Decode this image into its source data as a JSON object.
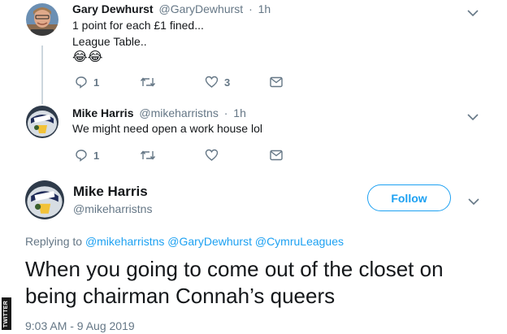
{
  "tweet1": {
    "name": "Gary Dewhurst",
    "handle": "@GaryDewhurst",
    "separator": "·",
    "time": "1h",
    "line1": "1 point for each £1 fined...",
    "line2": "League Table..",
    "emoji": "😂😂",
    "actions": {
      "replies": "1",
      "retweets": "",
      "likes": "3"
    }
  },
  "tweet2": {
    "name": "Mike Harris",
    "handle": "@mikeharristns",
    "separator": "·",
    "time": "1h",
    "text": "We might need open a work house lol",
    "actions": {
      "replies": "1",
      "retweets": "",
      "likes": ""
    }
  },
  "main_tweet": {
    "name": "Mike Harris",
    "handle": "@mikeharristns",
    "follow_label": "Follow",
    "replying_prefix": "Replying to",
    "replying_to": [
      "@mikeharristns",
      "@GaryDewhurst",
      "@CymruLeagues"
    ],
    "text": "When you going to come out of the closet on being chairman Connah’s queers",
    "timestamp": "9:03 AM - 9 Aug 2019"
  },
  "watermark": "TWITTER",
  "colors": {
    "accent": "#1da1f2",
    "secondary_text": "#657786",
    "primary_text": "#14171a",
    "thread_line": "#ccd6dd"
  },
  "icons": [
    "reply-icon",
    "retweet-icon",
    "like-icon",
    "message-icon",
    "chevron-down-icon"
  ]
}
